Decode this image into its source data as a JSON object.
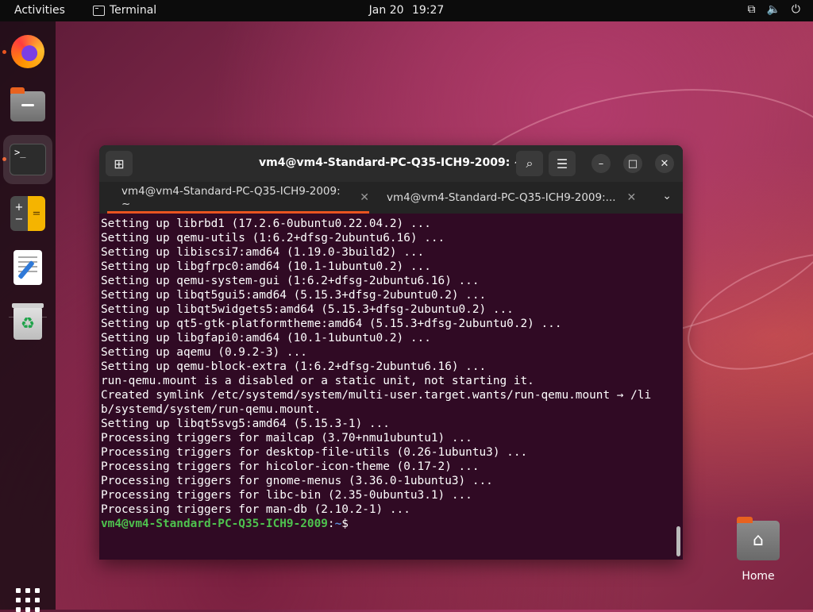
{
  "topbar": {
    "activities": "Activities",
    "app_name": "Terminal",
    "date": "Jan 20",
    "time": "19:27",
    "tray_icons": [
      "network-icon",
      "volume-icon",
      "power-icon"
    ]
  },
  "dock": {
    "items": [
      "firefox",
      "files",
      "terminal",
      "calculator",
      "text-editor",
      "trash"
    ],
    "running": [
      "firefox",
      "terminal"
    ]
  },
  "window": {
    "title": "vm4@vm4-Standard-PC-Q35-ICH9-2009: ~",
    "tabs": [
      {
        "label": "vm4@vm4-Standard-PC-Q35-ICH9-2009: ~",
        "active": true
      },
      {
        "label": "vm4@vm4-Standard-PC-Q35-ICH9-2009:...",
        "active": false
      }
    ]
  },
  "terminal": {
    "lines": [
      "Setting up librbd1 (17.2.6-0ubuntu0.22.04.2) ...",
      "Setting up qemu-utils (1:6.2+dfsg-2ubuntu6.16) ...",
      "Setting up libiscsi7:amd64 (1.19.0-3build2) ...",
      "Setting up libgfrpc0:amd64 (10.1-1ubuntu0.2) ...",
      "Setting up qemu-system-gui (1:6.2+dfsg-2ubuntu6.16) ...",
      "Setting up libqt5gui5:amd64 (5.15.3+dfsg-2ubuntu0.2) ...",
      "Setting up libqt5widgets5:amd64 (5.15.3+dfsg-2ubuntu0.2) ...",
      "Setting up qt5-gtk-platformtheme:amd64 (5.15.3+dfsg-2ubuntu0.2) ...",
      "Setting up libgfapi0:amd64 (10.1-1ubuntu0.2) ...",
      "Setting up aqemu (0.9.2-3) ...",
      "Setting up qemu-block-extra (1:6.2+dfsg-2ubuntu6.16) ...",
      "run-qemu.mount is a disabled or a static unit, not starting it.",
      "Created symlink /etc/systemd/system/multi-user.target.wants/run-qemu.mount → /li",
      "b/systemd/system/run-qemu.mount.",
      "Setting up libqt5svg5:amd64 (5.15.3-1) ...",
      "Processing triggers for mailcap (3.70+nmu1ubuntu1) ...",
      "Processing triggers for desktop-file-utils (0.26-1ubuntu3) ...",
      "Processing triggers for hicolor-icon-theme (0.17-2) ...",
      "Processing triggers for gnome-menus (3.36.0-1ubuntu3) ...",
      "Processing triggers for libc-bin (2.35-0ubuntu3.1) ...",
      "Processing triggers for man-db (2.10.2-1) ..."
    ],
    "prompt_user": "vm4@vm4-Standard-PC-Q35-ICH9-2009",
    "prompt_sep": ":",
    "prompt_path": "~",
    "prompt_symbol": "$ "
  },
  "desktop": {
    "home_label": "Home"
  }
}
